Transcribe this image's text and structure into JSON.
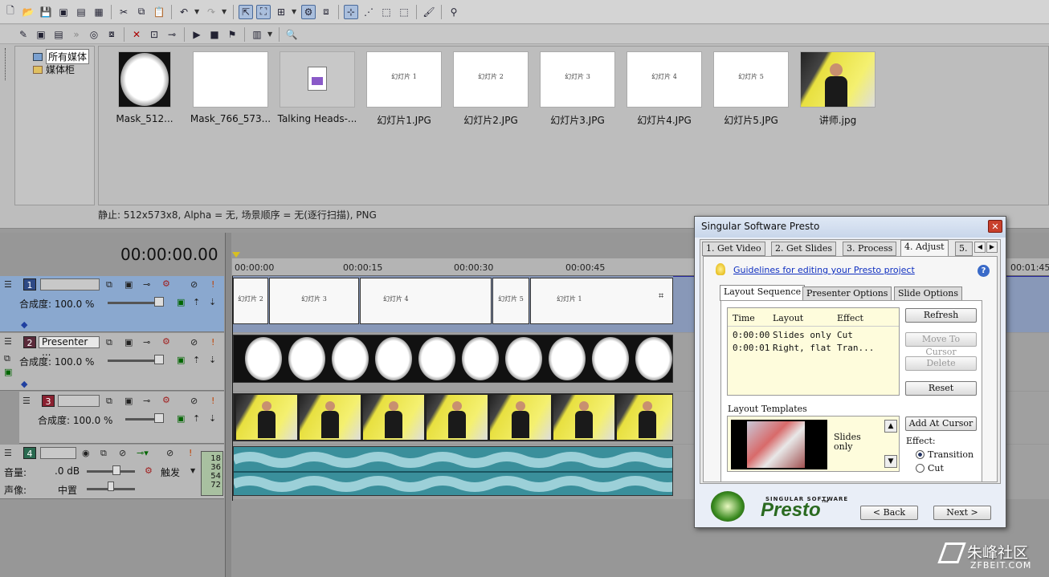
{
  "toolbar1": {
    "icons": [
      "new-icon",
      "open-icon",
      "save-icon",
      "save-as-icon",
      "render-icon",
      "properties-icon",
      "cut-icon",
      "copy-icon",
      "paste-icon",
      "undo-icon",
      "redo-icon",
      "normal-edit-icon",
      "envelope-edit-icon",
      "selection-icon",
      "auto-ripple-icon",
      "lock-envelopes-icon",
      "snapping-icon",
      "ignore-grouping-icon",
      "auto-crossfade-icon",
      "marker-icon",
      "help-icon"
    ]
  },
  "toolbar2": {
    "icons": [
      "import-icon",
      "capture-icon",
      "get-media-icon",
      "web-icon",
      "burn-icon",
      "properties-icon",
      "delete-icon",
      "media-fx-icon",
      "pan-icon",
      "play-icon",
      "stop-icon",
      "auto-preview-icon",
      "views-icon",
      "search-icon"
    ]
  },
  "explorer": {
    "tree": [
      {
        "label": "所有媒体"
      },
      {
        "label": "媒体柜"
      }
    ]
  },
  "media": [
    {
      "label": "Mask_512...",
      "type": "mask"
    },
    {
      "label": "Mask_766_573...",
      "type": "blank"
    },
    {
      "label": "Talking Heads-...",
      "type": "file"
    },
    {
      "label": "幻灯片1.JPG",
      "type": "slide",
      "text": "幻灯片 1"
    },
    {
      "label": "幻灯片2.JPG",
      "type": "slide",
      "text": "幻灯片 2"
    },
    {
      "label": "幻灯片3.JPG",
      "type": "slide",
      "text": "幻灯片 3"
    },
    {
      "label": "幻灯片4.JPG",
      "type": "slide",
      "text": "幻灯片 4"
    },
    {
      "label": "幻灯片5.JPG",
      "type": "slide",
      "text": "幻灯片 5"
    },
    {
      "label": "讲师.jpg",
      "type": "photo"
    }
  ],
  "status": "静止: 512x573x8, Alpha = 无, 场景顺序 = 无(逐行扫描), PNG",
  "timeline": {
    "timecode": "00:00:00.00",
    "ruler": [
      "00:00:00",
      "00:00:15",
      "00:00:30",
      "00:00:45",
      "00:01:45"
    ],
    "tracks": [
      {
        "num": "1",
        "name": "",
        "opacity": "合成度: 100.0 %",
        "color": "#2e4a86"
      },
      {
        "num": "2",
        "name": "Presenter ...",
        "opacity": "合成度: 100.0 %",
        "color": "#5a2a3a"
      },
      {
        "num": "3",
        "name": "",
        "opacity": "合成度: 100.0 %",
        "color": "#8a2030"
      },
      {
        "num": "4",
        "name": "",
        "volume_label": "音量:",
        "volume": ".0 dB",
        "pan_label": "声像:",
        "pan": "中置",
        "mode": "触发",
        "meter": [
          "18",
          "36",
          "54",
          "72"
        ],
        "color": "#2a6a50"
      }
    ],
    "slide_clips": [
      "幻灯片 2",
      "幻灯片 3",
      "幻灯片 4",
      "幻灯片 5",
      "幻灯片 1"
    ]
  },
  "dialog": {
    "title": "Singular Software Presto",
    "tabs": [
      "1. Get Video",
      "2. Get Slides",
      "3. Process",
      "4. Adjust",
      "5."
    ],
    "link": "Guidelines for editing your Presto project",
    "subtabs": [
      "Layout Sequence",
      "Presenter Options",
      "Slide Options"
    ],
    "table": {
      "headers": [
        "Time",
        "Layout",
        "Effect"
      ],
      "rows": [
        [
          "0:00:00",
          "Slides only",
          "Cut"
        ],
        [
          "0:00:01",
          "Right, flat",
          "Tran..."
        ]
      ]
    },
    "buttons": {
      "refresh": "Refresh",
      "move": "Move To Cursor",
      "delete": "Delete",
      "reset": "Reset",
      "add": "Add At Cursor",
      "back": "< Back",
      "next": "Next >"
    },
    "templates_label": "Layout Templates",
    "template_name": "Slides only",
    "effect_label": "Effect:",
    "effects": [
      "Transition",
      "Cut"
    ],
    "selected_effect": "Transition",
    "brand_small": "SINGULAR SOFTWARE",
    "brand": "Presto",
    "tm": "™"
  },
  "watermark": {
    "text": "朱峰社区",
    "sub": "ZFBEIT.COM"
  }
}
